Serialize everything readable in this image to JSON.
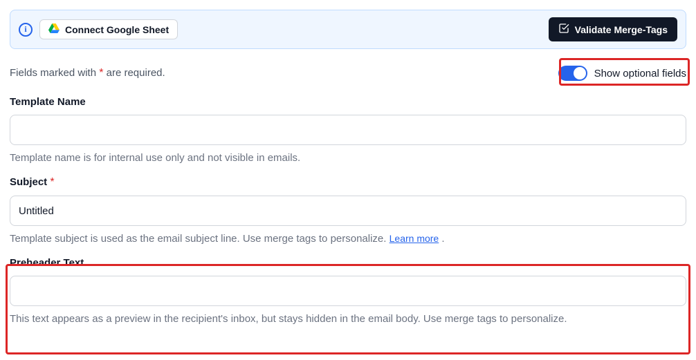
{
  "banner": {
    "connect_label": "Connect Google Sheet",
    "validate_label": "Validate Merge-Tags"
  },
  "meta": {
    "required_prefix": "Fields marked with ",
    "required_star": "*",
    "required_suffix": " are required.",
    "toggle_label": "Show optional fields"
  },
  "fields": {
    "template_name": {
      "label": "Template Name",
      "value": "",
      "help": "Template name is for internal use only and not visible in emails."
    },
    "subject": {
      "label": "Subject",
      "value": "Untitled",
      "help": "Template subject is used as the email subject line. Use merge tags to personalize. ",
      "learn_more": "Learn more",
      "period": " ."
    },
    "preheader": {
      "label": "Preheader Text",
      "value": "",
      "help": "This text appears as a preview in the recipient's inbox, but stays hidden in the email body. Use merge tags to personalize."
    }
  }
}
